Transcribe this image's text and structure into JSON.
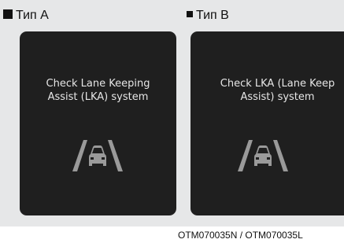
{
  "panel_a": {
    "label": "Тип A",
    "message_line1": "Check Lane Keeping",
    "message_line2": "Assist (LKA) system"
  },
  "panel_b": {
    "label": "Тип B",
    "message_line1": "Check LKA (Lane Keep",
    "message_line2": "Assist) system"
  },
  "figure_code": "OTM070035N / OTM070035L",
  "icons": {
    "lane": "lane-keeping-car-icon",
    "bullet": "square-bullet-icon"
  },
  "colors": {
    "background_panel": "#e6e7e8",
    "screen": "#1f1f1f",
    "screen_text": "#e6e6e6",
    "icon": "#9a9a9a"
  }
}
